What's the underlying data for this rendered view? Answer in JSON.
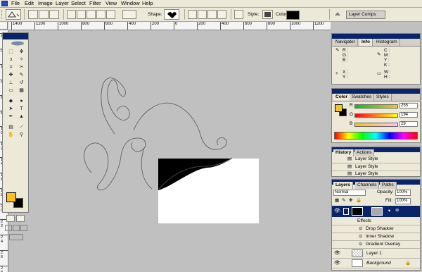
{
  "menu": [
    "File",
    "Edit",
    "Image",
    "Layer",
    "Select",
    "Filter",
    "View",
    "Window",
    "Help"
  ],
  "options_bar": {
    "shape_label": "Shape:",
    "style_label": "Style:",
    "color_label": "Color:",
    "layer_comps_label": "Layer Comps"
  },
  "ruler": {
    "h_ticks": [
      "1400",
      "1200",
      "1000",
      "800",
      "600",
      "400",
      "200",
      "0",
      "200",
      "400",
      "600",
      "800",
      "1000",
      "1200"
    ],
    "v_ticks": [
      "2",
      "0",
      "2",
      "4",
      "6",
      "8",
      "10",
      "12",
      "14",
      "16",
      "18",
      "20",
      "22",
      "24",
      "26",
      "28"
    ]
  },
  "navigator_panel": {
    "tabs": [
      "Navigator",
      "Info",
      "Histogram"
    ],
    "active_tab": "Info",
    "rgb_labels": [
      "R :",
      "G :",
      "B :"
    ],
    "cmyk_labels": [
      "C :",
      "M :",
      "Y :",
      "K :"
    ],
    "xy_labels": [
      "X :",
      "Y :"
    ],
    "wh_labels": [
      "W :",
      "H :"
    ]
  },
  "color_panel": {
    "tabs": [
      "Color",
      "Swatches",
      "Styles"
    ],
    "active_tab": "Color",
    "channels": [
      {
        "label": "R",
        "value": "255"
      },
      {
        "label": "G",
        "value": "194"
      },
      {
        "label": "B",
        "value": "29"
      }
    ],
    "foreground": "#ffc21d"
  },
  "history_panel": {
    "tabs": [
      "History",
      "Actions"
    ],
    "active_tab": "History",
    "items": [
      "Layer Style",
      "Layer Style",
      "Layer Style"
    ]
  },
  "layers_panel": {
    "tabs": [
      "Layers",
      "Channels",
      "Paths"
    ],
    "active_tab": "Layers",
    "blend_mode": "Normal",
    "opacity_label": "Opacity:",
    "opacity_value": "100%",
    "fill_label": "Fill:",
    "fill_value": "100%",
    "effects_label": "Effects",
    "effects": [
      "Drop Shadow",
      "Inner Shadow",
      "Gradient Overlay"
    ],
    "layers": [
      "Layer 1",
      "Background"
    ]
  },
  "colors": {
    "accent": "#0a246a",
    "foreground_swatch": "#ffc21d",
    "canvas_bg": "#c0c0c0"
  }
}
